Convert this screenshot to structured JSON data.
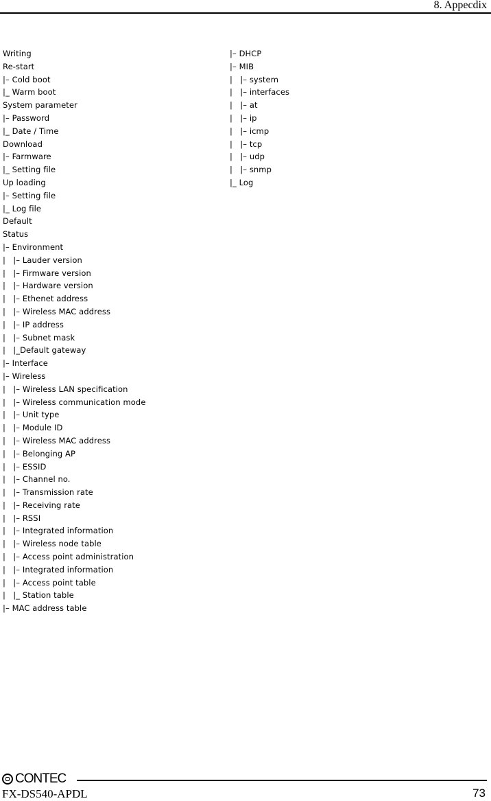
{
  "header": {
    "section_title": "8. Appecdix"
  },
  "menu_tree": {
    "left_column": [
      "Writing",
      "Re-start",
      "|– Cold boot",
      "|_ Warm boot",
      "System parameter",
      "|– Password",
      "|_ Date / Time",
      "Download",
      "|– Farmware",
      "|_ Setting file",
      "Up loading",
      "|– Setting file",
      "|_ Log file",
      "Default",
      "Status",
      "|– Environment",
      "|   |– Lauder version",
      "|   |– Firmware version",
      "|   |– Hardware version",
      "|   |– Ethenet address",
      "|   |– Wireless MAC address",
      "|   |– IP address",
      "|   |– Subnet mask",
      "|   |_Default gateway",
      "|– Interface",
      "|– Wireless",
      "|   |– Wireless LAN specification",
      "|   |– Wireless communication mode",
      "|   |– Unit type",
      "|   |– Module ID",
      "|   |– Wireless MAC address",
      "|   |– Belonging AP",
      "|   |– ESSID",
      "|   |– Channel no.",
      "|   |– Transmission rate",
      "|   |– Receiving rate",
      "|   |– RSSI",
      "|   |– Integrated information",
      "|   |– Wireless node table",
      "|   |– Access point administration",
      "|   |– Integrated information",
      "|   |– Access point table",
      "|   |_ Station table",
      "|– MAC address table"
    ],
    "right_column": [
      "|– DHCP",
      "|– MIB",
      "|   |– system",
      "|   |– interfaces",
      "|   |– at",
      "|   |– ip",
      "|   |– icmp",
      "|   |– tcp",
      "|   |– udp",
      "|   |– snmp",
      "|_ Log"
    ]
  },
  "footer": {
    "brand": "CONTEC",
    "brand_icon": "contec-logo-icon",
    "model": "FX-DS540-APDL",
    "page_number": "73"
  }
}
